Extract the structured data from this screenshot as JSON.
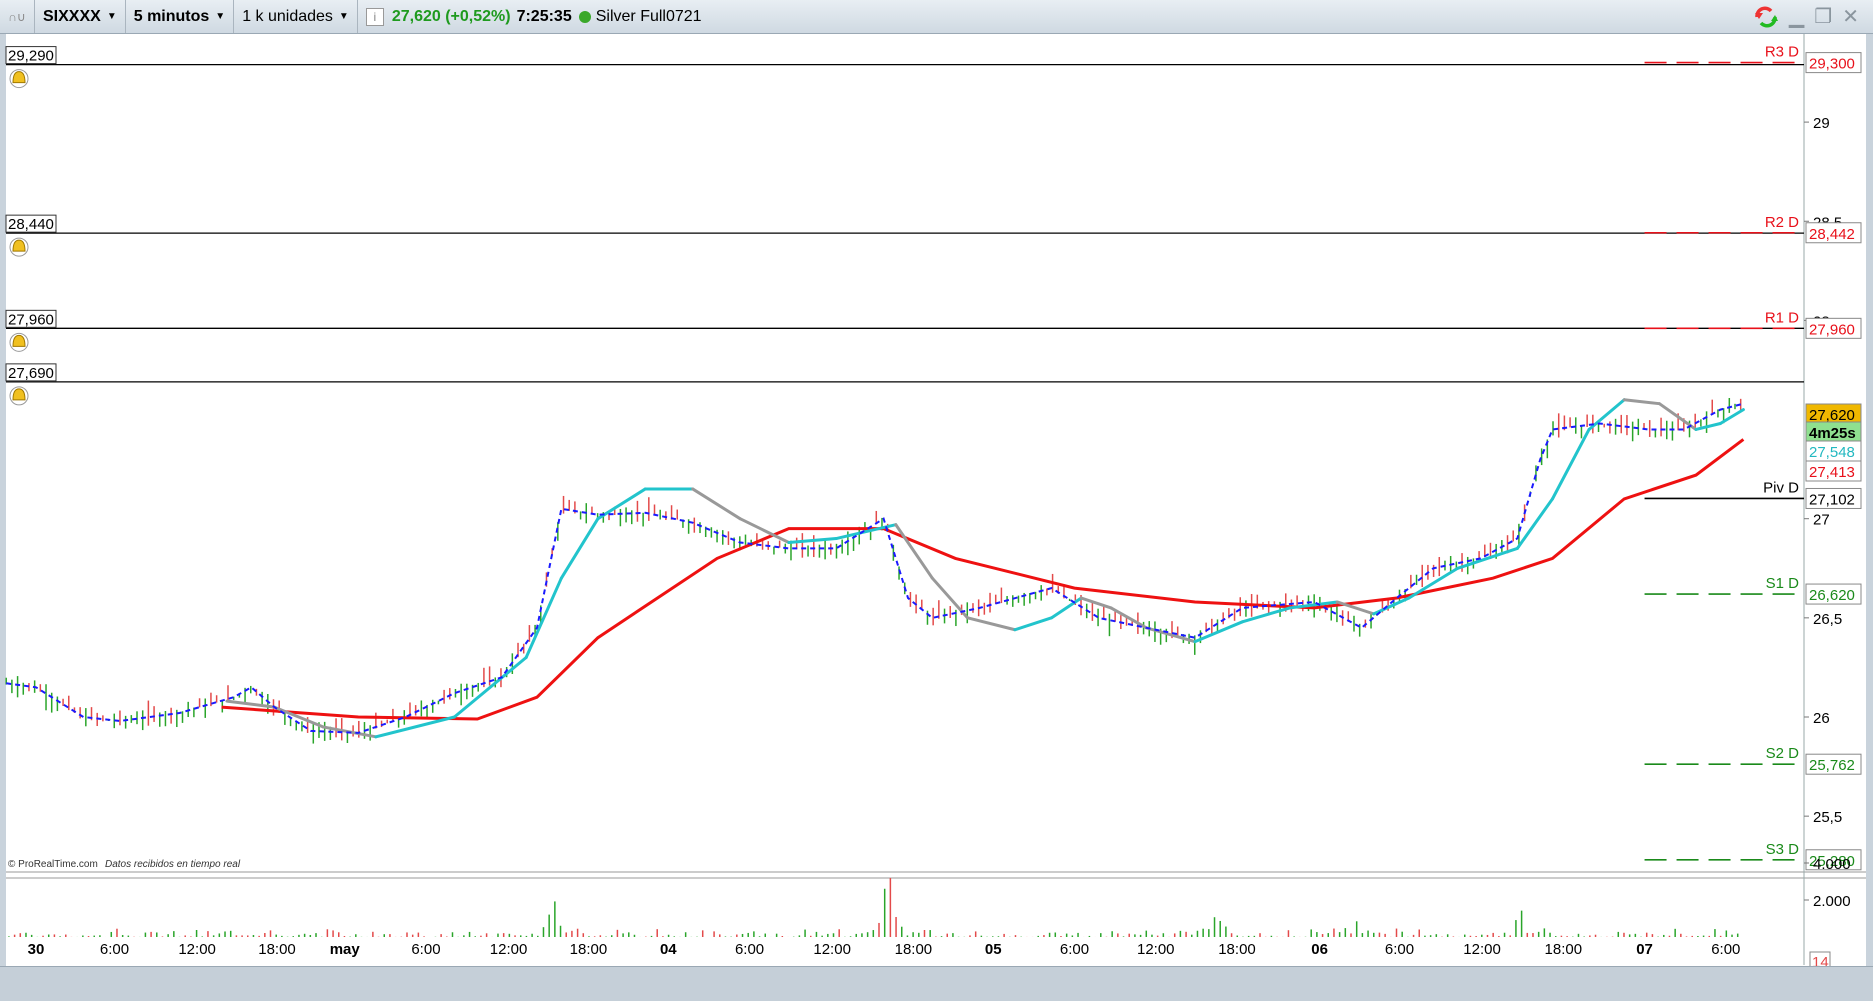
{
  "toolbar": {
    "grip": "∩∪",
    "symbol": "SIXXXX",
    "timeframe": "5 minutos",
    "units": "1 k unidades",
    "info_icon": "i",
    "quote": "27,620 (+0,52%)",
    "time": "7:25:35",
    "feed_status": "Silver Full0721",
    "colors": {
      "quote": "#1e9a1e",
      "status": "#3aa82a"
    }
  },
  "window_controls": [
    "refresh-icon",
    "minimize-icon",
    "restore-icon",
    "close-icon"
  ],
  "alerts": [
    {
      "label": "29,290",
      "value": 29.29
    },
    {
      "label": "28,440",
      "value": 28.44
    },
    {
      "label": "27,960",
      "value": 27.96
    },
    {
      "label": "27,690",
      "value": 27.69
    }
  ],
  "pivots": [
    {
      "name": "R3 D",
      "label": "29,300",
      "value": 29.3,
      "color": "#e8101a"
    },
    {
      "name": "R2 D",
      "label": "28,442",
      "value": 28.442,
      "color": "#e8101a"
    },
    {
      "name": "R1 D",
      "label": "27,960",
      "value": 27.96,
      "color": "#e8101a"
    },
    {
      "name": "Piv D",
      "label": "27,102",
      "value": 27.102,
      "color": "#000000"
    },
    {
      "name": "S1 D",
      "label": "26,620",
      "value": 26.62,
      "color": "#1a8a1a"
    },
    {
      "name": "S2 D",
      "label": "25,762",
      "value": 25.762,
      "color": "#1a8a1a"
    },
    {
      "name": "S3 D",
      "label": "25,280",
      "value": 25.28,
      "color": "#1a8a1a"
    }
  ],
  "price_badges": {
    "last": "27,620",
    "countdown": "4m25s",
    "ma_fast": "27,548",
    "ma_slow": "27,413"
  },
  "watermark": {
    "brand": "© ProRealTime.com",
    "text": "Datos recibidos en tiempo real"
  },
  "volume_axis": {
    "ticks": [
      {
        "label": "4.000",
        "value": 4000
      },
      {
        "label": "2.000",
        "value": 2000
      }
    ],
    "last": "14"
  },
  "chart_data": {
    "type": "line",
    "title": "SIXXXX 5 minutos",
    "xunit": "trading hours since 30 00:00",
    "ylim": [
      25.2,
      29.45
    ],
    "yticks": [
      {
        "label": "29",
        "value": 29
      },
      {
        "label": "28,5",
        "value": 28.5
      },
      {
        "label": "28",
        "value": 28
      },
      {
        "label": "27",
        "value": 27
      },
      {
        "label": "26,5",
        "value": 26.5
      },
      {
        "label": "26",
        "value": 26
      },
      {
        "label": "25,5",
        "value": 25.5
      }
    ],
    "xticks": [
      {
        "label": "30",
        "h": 0,
        "bold": true
      },
      {
        "label": "6:00",
        "h": 5.8
      },
      {
        "label": "12:00",
        "h": 11.9
      },
      {
        "label": "18:00",
        "h": 17.8
      },
      {
        "label": "may",
        "h": 22.8,
        "bold": true
      },
      {
        "label": "6:00",
        "h": 28.8
      },
      {
        "label": "12:00",
        "h": 34.9
      },
      {
        "label": "18:00",
        "h": 40.8
      },
      {
        "label": "04",
        "h": 46.7,
        "bold": true
      },
      {
        "label": "6:00",
        "h": 52.7
      },
      {
        "label": "12:00",
        "h": 58.8
      },
      {
        "label": "18:00",
        "h": 64.8
      },
      {
        "label": "05",
        "h": 70.7,
        "bold": true
      },
      {
        "label": "6:00",
        "h": 76.7
      },
      {
        "label": "12:00",
        "h": 82.7
      },
      {
        "label": "18:00",
        "h": 88.7
      },
      {
        "label": "06",
        "h": 94.8,
        "bold": true
      },
      {
        "label": "6:00",
        "h": 100.7
      },
      {
        "label": "12:00",
        "h": 106.8
      },
      {
        "label": "18:00",
        "h": 112.8
      },
      {
        "label": "07",
        "h": 118.8,
        "bold": true
      },
      {
        "label": "6:00",
        "h": 124.8
      }
    ],
    "series": [
      {
        "name": "price",
        "color": "#1a1aff",
        "points": [
          [
            -2.2,
            26.17
          ],
          [
            0,
            26.15
          ],
          [
            3.5,
            26.0
          ],
          [
            6.2,
            25.98
          ],
          [
            10.6,
            26.02
          ],
          [
            14.6,
            26.1
          ],
          [
            15.9,
            26.15
          ],
          [
            17.6,
            26.05
          ],
          [
            20.3,
            25.93
          ],
          [
            23.8,
            25.92
          ],
          [
            27.3,
            26.0
          ],
          [
            30.9,
            26.12
          ],
          [
            34.4,
            26.2
          ],
          [
            37.0,
            26.45
          ],
          [
            38.8,
            27.05
          ],
          [
            41.5,
            27.02
          ],
          [
            45.0,
            27.03
          ],
          [
            48.5,
            26.98
          ],
          [
            52.0,
            26.88
          ],
          [
            55.6,
            26.85
          ],
          [
            59.1,
            26.85
          ],
          [
            62.6,
            27.0
          ],
          [
            64.4,
            26.6
          ],
          [
            66.2,
            26.5
          ],
          [
            69.7,
            26.55
          ],
          [
            75.0,
            26.65
          ],
          [
            78.5,
            26.5
          ],
          [
            82.0,
            26.45
          ],
          [
            85.6,
            26.4
          ],
          [
            89.1,
            26.55
          ],
          [
            94.4,
            26.58
          ],
          [
            97.9,
            26.45
          ],
          [
            100.5,
            26.6
          ],
          [
            103.2,
            26.75
          ],
          [
            106.7,
            26.8
          ],
          [
            109.4,
            26.9
          ],
          [
            111.1,
            27.3
          ],
          [
            112.0,
            27.45
          ],
          [
            115.5,
            27.48
          ],
          [
            119.1,
            27.45
          ],
          [
            121.7,
            27.45
          ],
          [
            124.4,
            27.55
          ],
          [
            126.1,
            27.58
          ]
        ]
      },
      {
        "name": "ma_slow",
        "color": "#ee1111",
        "points": [
          [
            13.7,
            26.05
          ],
          [
            23.8,
            26.0
          ],
          [
            32.6,
            25.99
          ],
          [
            37.0,
            26.1
          ],
          [
            41.5,
            26.4
          ],
          [
            45.9,
            26.6
          ],
          [
            50.3,
            26.8
          ],
          [
            55.6,
            26.95
          ],
          [
            62.6,
            26.95
          ],
          [
            67.9,
            26.8
          ],
          [
            76.7,
            26.65
          ],
          [
            85.6,
            26.58
          ],
          [
            94.4,
            26.55
          ],
          [
            100.5,
            26.6
          ],
          [
            107.6,
            26.7
          ],
          [
            112.0,
            26.8
          ],
          [
            117.3,
            27.1
          ],
          [
            122.6,
            27.22
          ],
          [
            126.1,
            27.4
          ]
        ]
      },
      {
        "name": "ma_fast",
        "color": "#22c4cc",
        "color_falling": "#999999",
        "points": [
          [
            14.1,
            26.08
          ],
          [
            17.6,
            26.05
          ],
          [
            21.2,
            25.95
          ],
          [
            25.1,
            25.9
          ],
          [
            30.9,
            26.0
          ],
          [
            36.2,
            26.3
          ],
          [
            38.8,
            26.7
          ],
          [
            41.5,
            27.0
          ],
          [
            45.0,
            27.15
          ],
          [
            48.5,
            27.15
          ],
          [
            52.0,
            27.0
          ],
          [
            55.6,
            26.88
          ],
          [
            59.1,
            26.9
          ],
          [
            63.5,
            26.97
          ],
          [
            66.2,
            26.7
          ],
          [
            68.8,
            26.5
          ],
          [
            72.3,
            26.44
          ],
          [
            75.0,
            26.5
          ],
          [
            77.2,
            26.6
          ],
          [
            79.4,
            26.55
          ],
          [
            82.0,
            26.45
          ],
          [
            85.6,
            26.38
          ],
          [
            89.1,
            26.48
          ],
          [
            92.6,
            26.55
          ],
          [
            96.1,
            26.58
          ],
          [
            98.8,
            26.52
          ],
          [
            101.4,
            26.6
          ],
          [
            105.0,
            26.75
          ],
          [
            109.4,
            26.85
          ],
          [
            112.0,
            27.1
          ],
          [
            114.7,
            27.45
          ],
          [
            117.3,
            27.6
          ],
          [
            119.9,
            27.58
          ],
          [
            122.6,
            27.45
          ],
          [
            124.4,
            27.48
          ],
          [
            126.1,
            27.55
          ]
        ]
      }
    ],
    "volume_spikes": [
      [
        16,
        1400
      ],
      [
        38.5,
        2700
      ],
      [
        63,
        4600
      ],
      [
        87,
        1800
      ],
      [
        97.5,
        1600
      ],
      [
        110,
        3700
      ]
    ]
  }
}
